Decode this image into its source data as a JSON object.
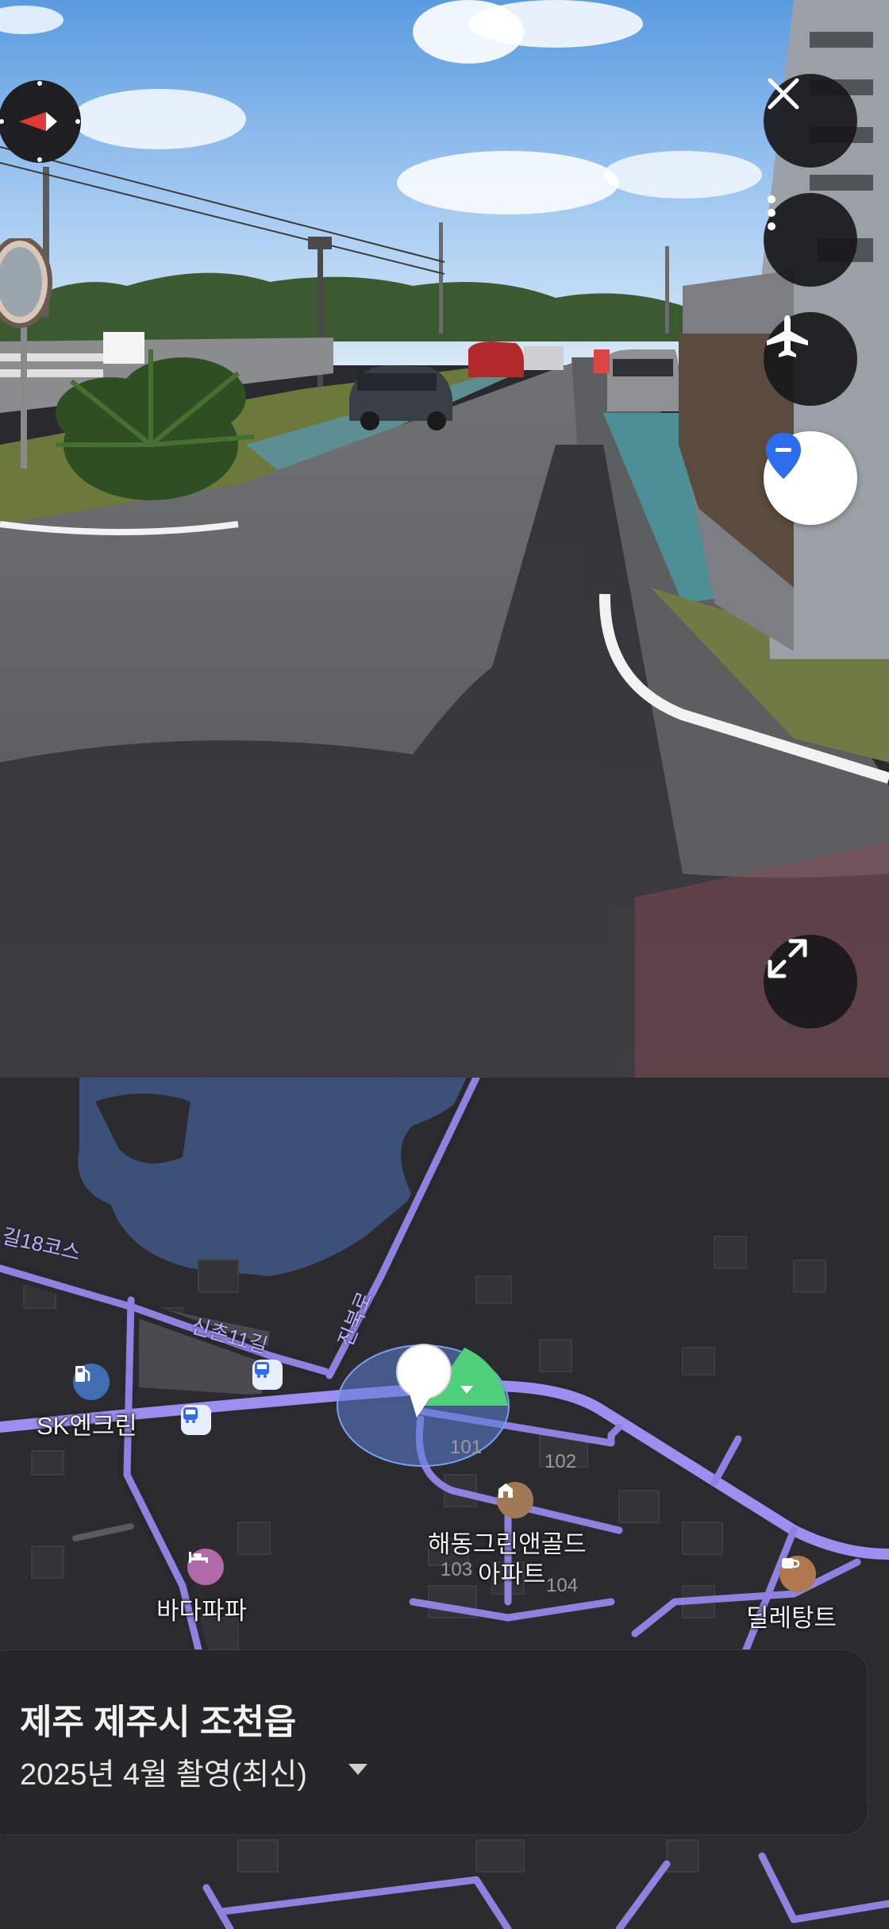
{
  "street_view": {
    "controls": {
      "close": "close-icon",
      "more": "more-vertical-icon",
      "flight": "airplane-icon",
      "pin": "location-pin-icon",
      "expand": "expand-icon"
    }
  },
  "map": {
    "labels": {
      "gas_station": "SK엔크린",
      "road_18": "길18코스",
      "road_sinchon": "신촌11길",
      "road_jinbuk": "진북로",
      "pension": "바다파파",
      "apartment_line1": "해동그린앤골드",
      "apartment_line2": "아파트",
      "cafe": "딜레탕트"
    },
    "buildings": [
      "101",
      "102",
      "103",
      "104"
    ]
  },
  "info": {
    "location": "제주 제주시 조천읍",
    "date": "2025년 4월 촬영(최신)"
  },
  "colors": {
    "road": "#9b8ff0",
    "water": "#3d5178",
    "map_bg": "#2b2b30",
    "view_cone": "#4fcf7a"
  }
}
